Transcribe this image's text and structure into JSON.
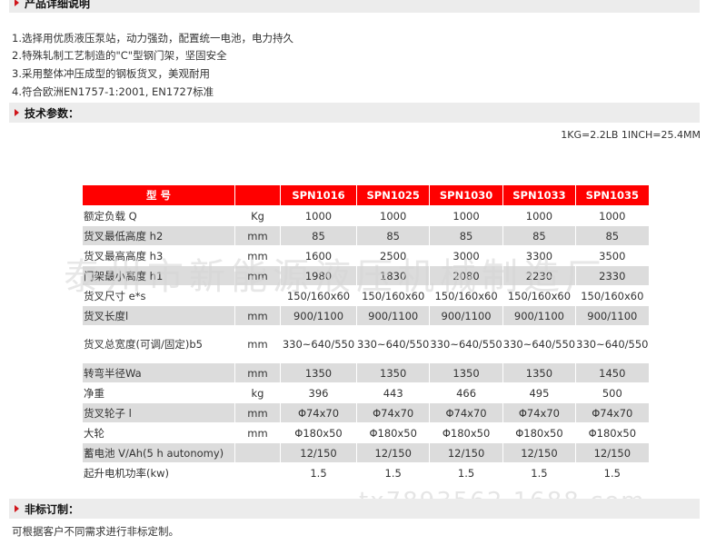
{
  "sections": {
    "details_title": "产品详细说明",
    "params_title": "技术参数：",
    "custom_title": "非标订制："
  },
  "features": [
    "1.选择用优质液压泵站，动力强劲，配置统一电池，电力持久",
    "2.特殊轧制工艺制造的\"C\"型钢门架，坚固安全",
    "3.采用整体冲压成型的钢板货叉，美观耐用",
    "4.符合欧洲EN1757-1:2001, EN1727标准"
  ],
  "conversion": "1KG=2.2LB 1INCH=25.4MM",
  "table": {
    "header": [
      "型 号",
      "",
      "SPN1016",
      "SPN1025",
      "SPN1030",
      "SPN1033",
      "SPN1035"
    ],
    "rows": [
      [
        "额定负载 Q",
        "Kg",
        "1000",
        "1000",
        "1000",
        "1000",
        "1000"
      ],
      [
        "货叉最低高度 h2",
        "mm",
        "85",
        "85",
        "85",
        "85",
        "85"
      ],
      [
        "货叉最高高度 h3",
        "mm",
        "1600",
        "2500",
        "3000",
        "3300",
        "3500"
      ],
      [
        "门架最小高度 h1",
        "mm",
        "1980",
        "1830",
        "2080",
        "2230",
        "2330"
      ],
      [
        "货叉尺寸 e*s",
        "",
        "150/160x60",
        "150/160x60",
        "150/160x60",
        "150/160x60",
        "150/160x60"
      ],
      [
        "货叉长度l",
        "mm",
        "900/1100",
        "900/1100",
        "900/1100",
        "900/1100",
        "900/1100"
      ],
      [
        "货叉总宽度(可调/固定)b5",
        "mm",
        "330~640/550",
        "330~640/550",
        "330~640/550",
        "330~640/550",
        "330~640/550"
      ],
      [
        "转弯半径Wa",
        "mm",
        "1350",
        "1350",
        "1350",
        "1350",
        "1450"
      ],
      [
        "净重",
        "kg",
        "396",
        "443",
        "466",
        "495",
        "500"
      ],
      [
        "货叉轮子 l",
        "mm",
        "Φ74x70",
        "Φ74x70",
        "Φ74x70",
        "Φ74x70",
        "Φ74x70"
      ],
      [
        "大轮",
        "mm",
        "Φ180x50",
        "Φ180x50",
        "Φ180x50",
        "Φ180x50",
        "Φ180x50"
      ],
      [
        "蓄电池 V/Ah(5 h autonomy)",
        "",
        "12/150",
        "12/150",
        "12/150",
        "12/150",
        "12/150"
      ],
      [
        "起升电机功率(kw)",
        "",
        "1.5",
        "1.5",
        "1.5",
        "1.5",
        "1.5"
      ]
    ]
  },
  "watermark": "泰州市新能源液压机械制造厂",
  "watermark2": "tx7893562.1688.com",
  "custom_note": "可根据客户不同需求进行非标定制。"
}
